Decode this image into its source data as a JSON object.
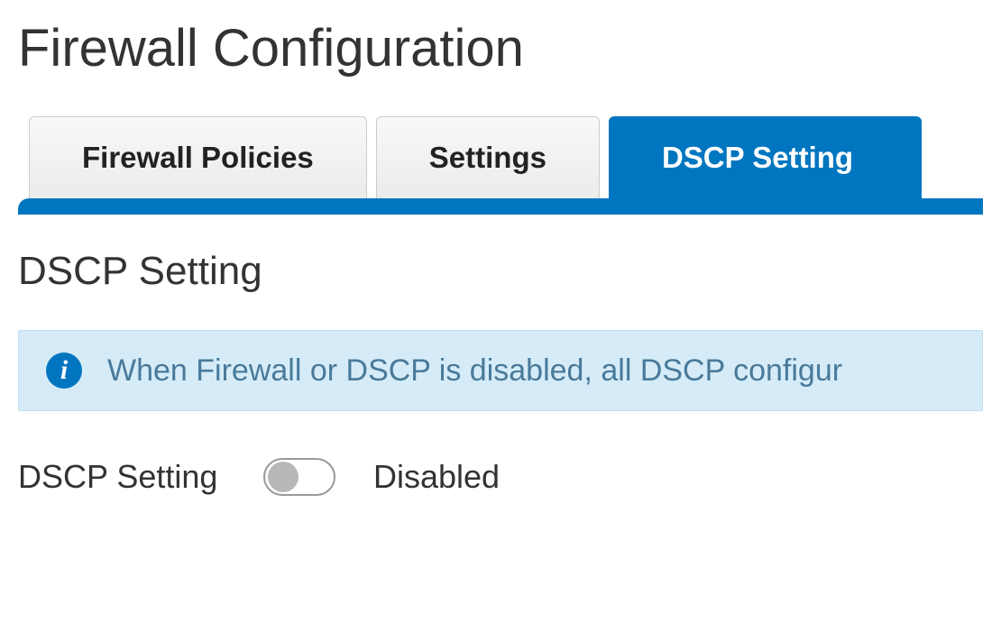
{
  "page_title": "Firewall Configuration",
  "tabs": [
    {
      "label": "Firewall Policies",
      "active": false
    },
    {
      "label": "Settings",
      "active": false
    },
    {
      "label": "DSCP Setting",
      "active": true
    }
  ],
  "section": {
    "title": "DSCP Setting",
    "info_banner": "When Firewall or DSCP is disabled, all DSCP configur",
    "dscp_setting": {
      "label": "DSCP Setting",
      "state": "Disabled",
      "enabled": false
    }
  },
  "icons": {
    "info": "i"
  }
}
